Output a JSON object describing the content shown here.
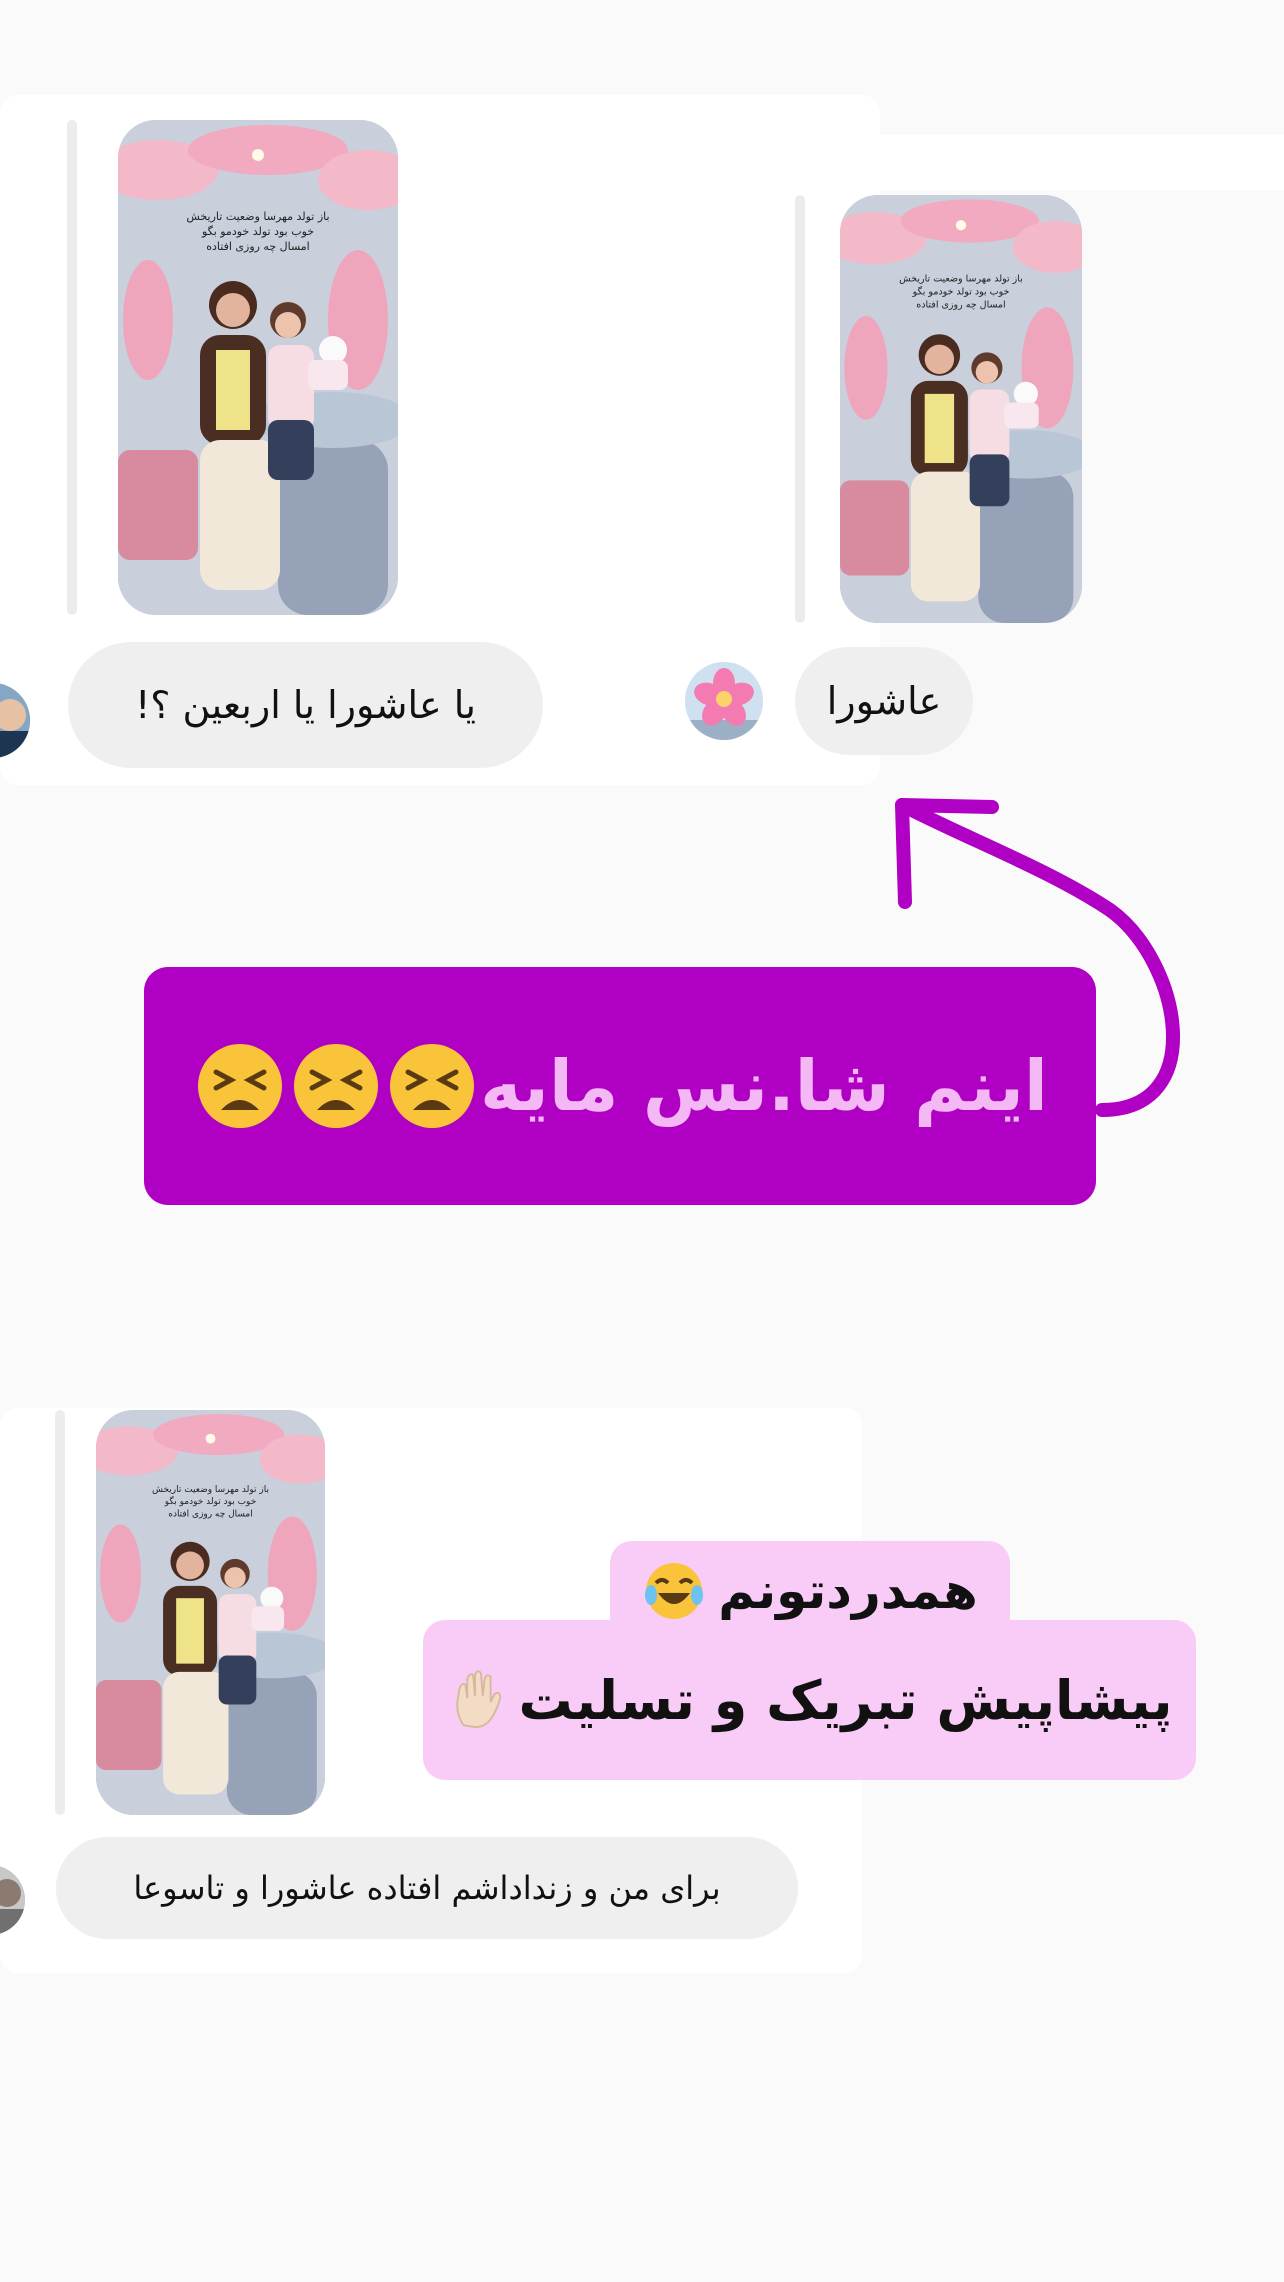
{
  "messages": {
    "top_left_reply": "یا عاشورا یا اربعین ؟!",
    "top_right_reply": "عاشورا",
    "bottom_reply": "برای من و زنداداشم افتاده عاشورا و تاسوعا"
  },
  "story": {
    "caption_line_1": "باز تولد مهرسا وضعیت تاریخش",
    "caption_line_2": "خوب بود تولد خودمو بگو",
    "caption_line_3": "امسال چه روزی افتاده"
  },
  "overlay": {
    "purple_sticker_text": "اینم شا.نس مایه",
    "pink_line_1": "همدردتونم",
    "pink_line_2": "پیشاپیش تبریک و تسلیت"
  },
  "colors": {
    "purple": "#b000c4",
    "purple_text": "#f4b8f4",
    "pink": "#f9ccf8",
    "bubble": "#efeff0"
  },
  "icons": {
    "flower_avatar": "cherry-blossom-emoji",
    "tired_face": "tired-face-emoji",
    "laugh": "tears-of-joy-emoji",
    "hand": "raised-hand-emoji"
  }
}
